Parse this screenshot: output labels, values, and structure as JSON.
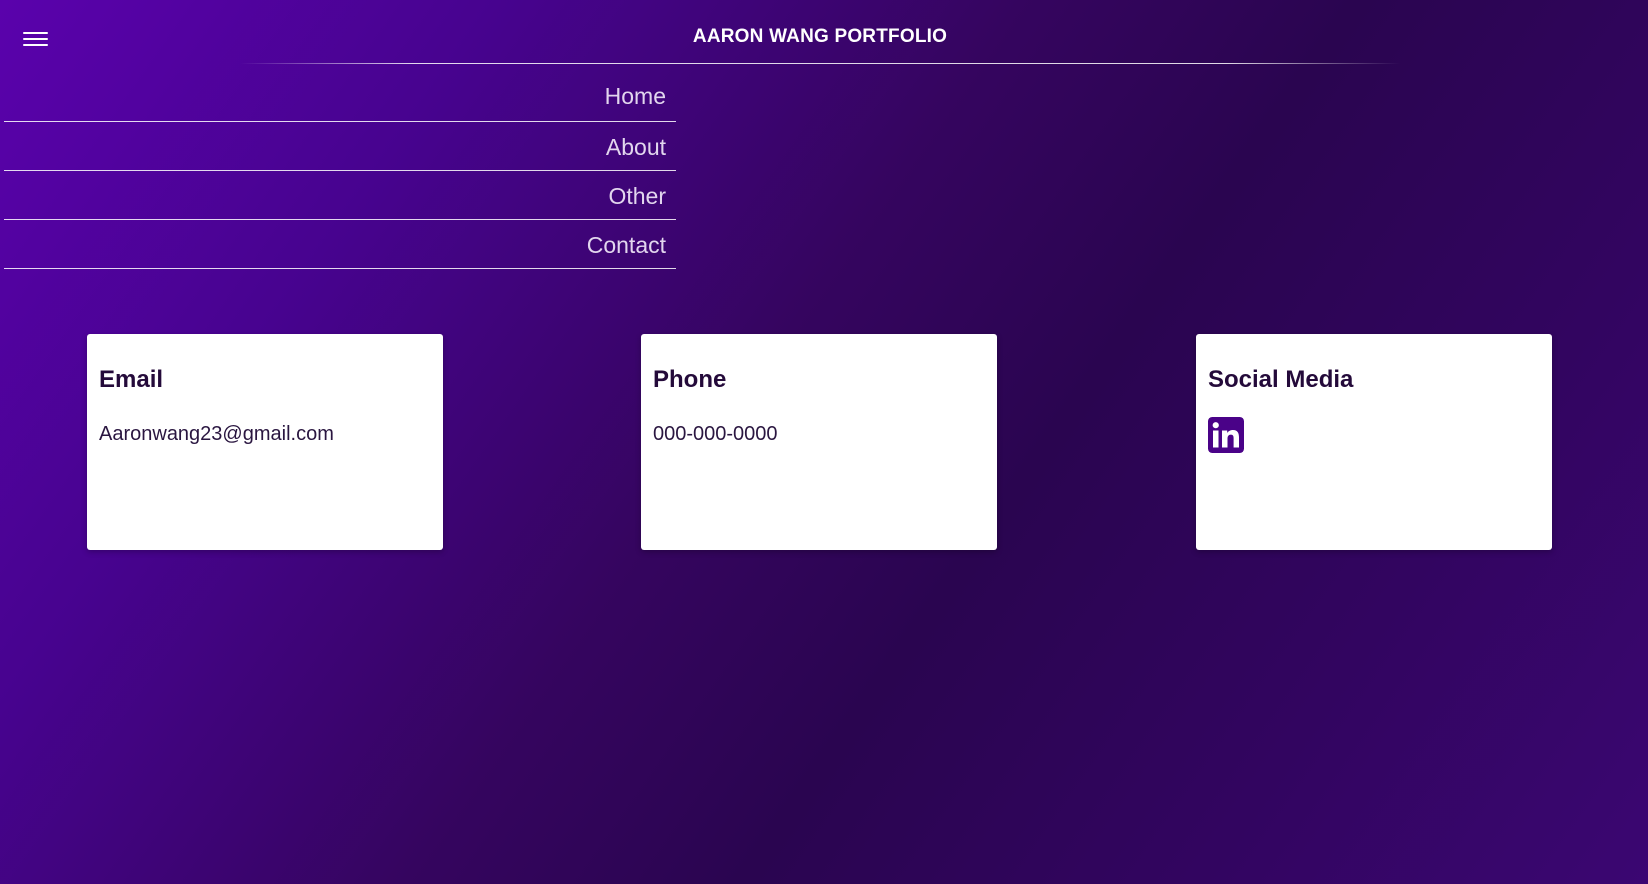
{
  "header": {
    "title": "AARON WANG PORTFOLIO",
    "menu_icon": "hamburger-menu-icon"
  },
  "nav": {
    "items": [
      {
        "label": "Home"
      },
      {
        "label": "About"
      },
      {
        "label": "Other"
      },
      {
        "label": "Contact"
      }
    ]
  },
  "contact": {
    "email": {
      "title": "Email",
      "value": "Aaronwang23@gmail.com"
    },
    "phone": {
      "title": "Phone",
      "value": "000-000-0000"
    },
    "social": {
      "title": "Social Media",
      "icon": "linkedin-icon"
    }
  },
  "colors": {
    "background_start": "#5a02ac",
    "background_end": "#2a0550",
    "accent": "#4a0288",
    "card_text": "#240a3a"
  }
}
